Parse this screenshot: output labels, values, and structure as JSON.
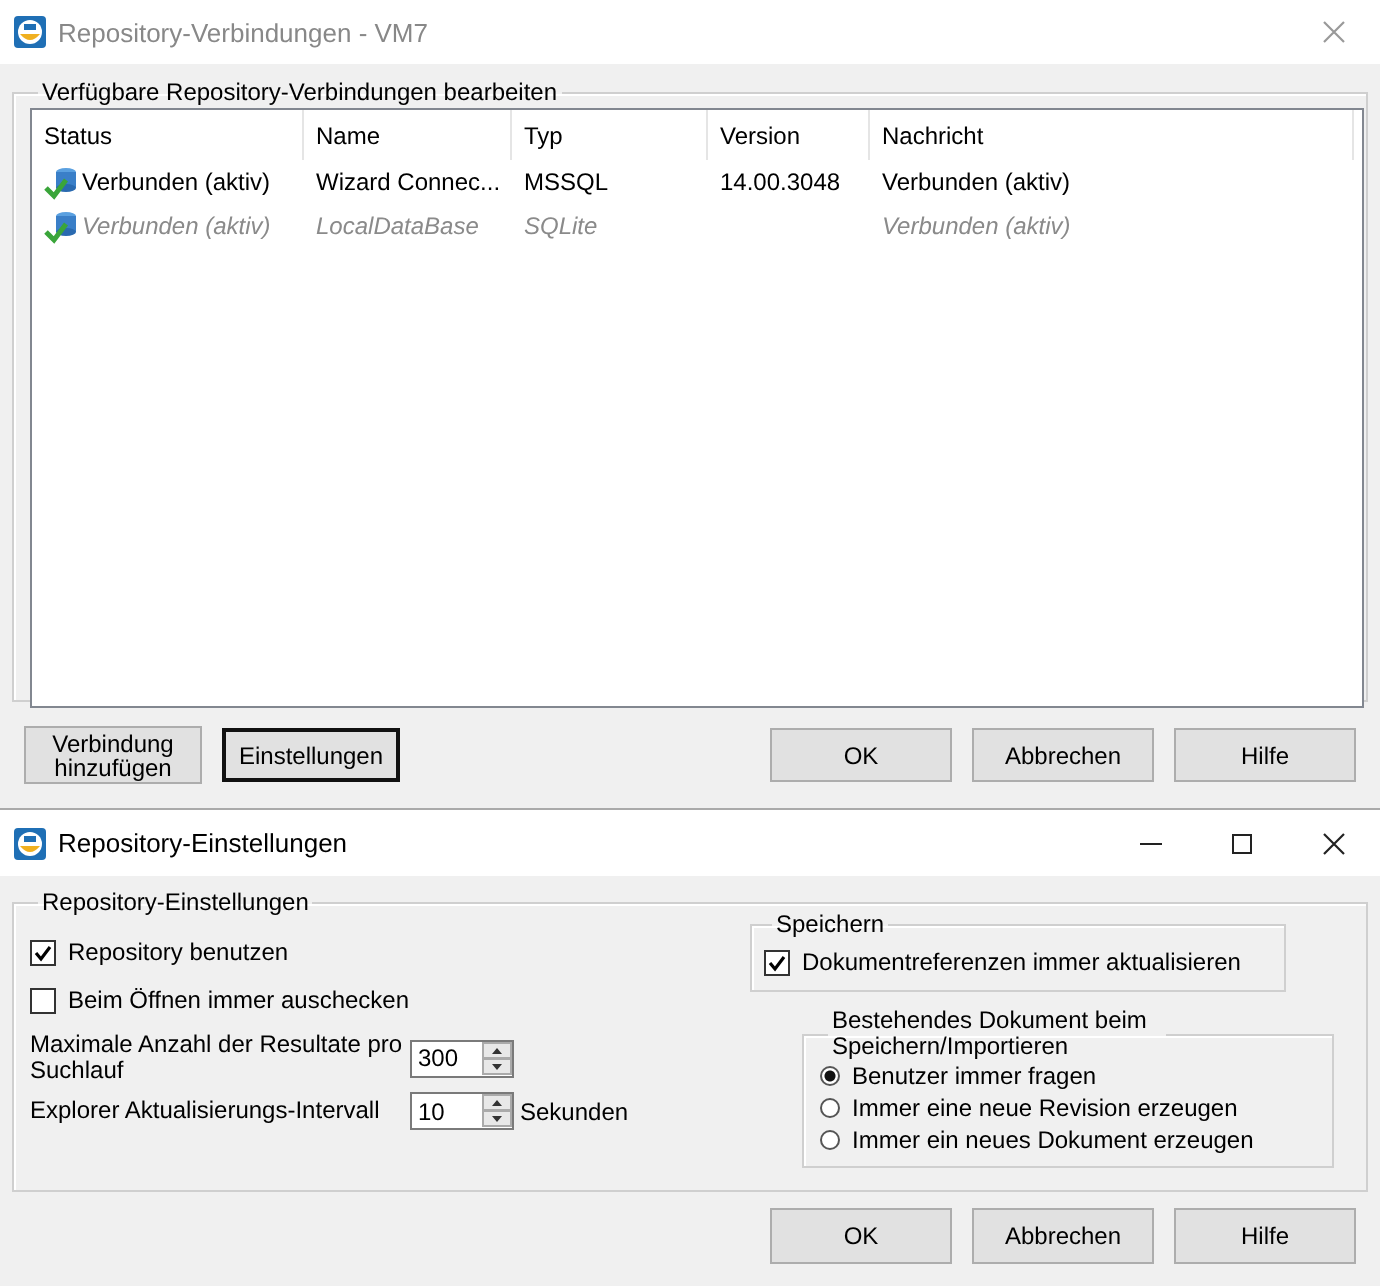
{
  "connections_window": {
    "title": "Repository-Verbindungen - VM7",
    "active": false,
    "group_title": "Verfügbare Repository-Verbindungen bearbeiten",
    "table": {
      "columns": [
        "Status",
        "Name",
        "Typ",
        "Version",
        "Nachricht"
      ],
      "rows": [
        {
          "cells": [
            "Verbunden (aktiv)",
            "Wizard Connec...",
            "MSSQL",
            "14.00.3048",
            "Verbunden (aktiv)"
          ],
          "disabled": false
        },
        {
          "cells": [
            "Verbunden (aktiv)",
            "LocalDataBase",
            "SQLite",
            "",
            "Verbunden (aktiv)"
          ],
          "disabled": true
        }
      ]
    },
    "left_buttons": [
      {
        "label": "Verbindung hinzufügen",
        "focused": false
      },
      {
        "label": "Einstellungen",
        "focused": true
      }
    ],
    "right_buttons": [
      {
        "label": "OK",
        "focused": false
      },
      {
        "label": "Abbrechen",
        "focused": false
      },
      {
        "label": "Hilfe",
        "focused": false
      }
    ]
  },
  "settings_window": {
    "title": "Repository-Einstellungen",
    "active": true,
    "group_title": "Repository-Einstellungen",
    "options": [
      {
        "kind": "checkbox",
        "label": "Repository benutzen",
        "checked": true
      },
      {
        "kind": "checkbox",
        "label": "Beim Öffnen immer auschecken",
        "checked": false
      },
      {
        "kind": "spin",
        "label": "Maximale Anzahl der Resultate pro Suchlauf",
        "value": "300"
      },
      {
        "kind": "spin",
        "label": "Explorer Aktualisierungs-Intervall",
        "value": "10",
        "unit": "Sekunden"
      }
    ],
    "save_group": {
      "title": "Speichern",
      "checkbox": {
        "label": "Dokumentreferenzen immer aktualisieren",
        "checked": true
      }
    },
    "existing_document": {
      "title": "Bestehendes Dokument beim Speichern/Importieren",
      "options": [
        {
          "label": "Benutzer immer fragen",
          "selected": true
        },
        {
          "label": "Immer eine neue Revision erzeugen",
          "selected": false
        },
        {
          "label": "Immer ein neues Dokument erzeugen",
          "selected": false
        }
      ]
    },
    "buttons": [
      {
        "label": "OK",
        "focused": false
      },
      {
        "label": "Abbrechen",
        "focused": false
      },
      {
        "label": "Hilfe",
        "focused": false
      }
    ]
  }
}
